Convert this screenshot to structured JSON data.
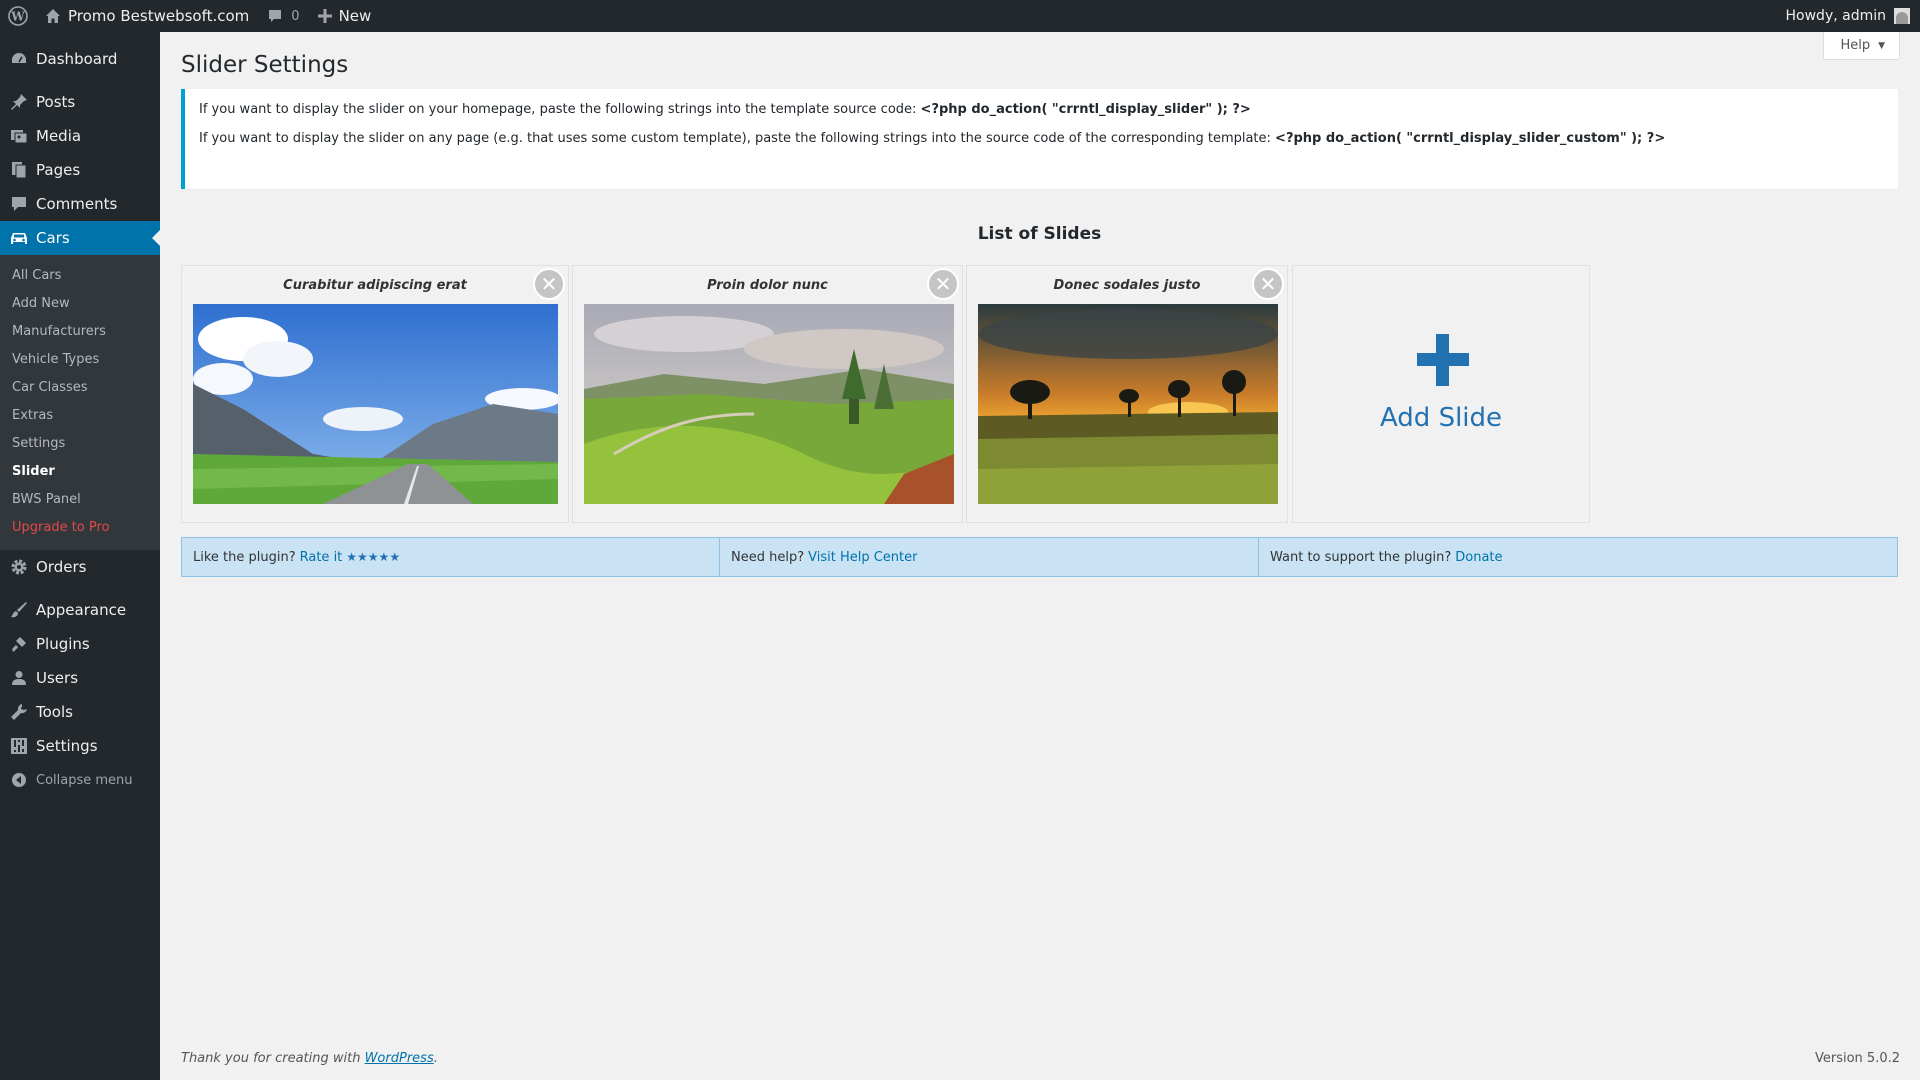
{
  "adminbar": {
    "site_name": "Promo Bestwebsoft.com",
    "comments_count": "0",
    "new_label": "New",
    "howdy": "Howdy, admin"
  },
  "sidebar": {
    "dashboard": "Dashboard",
    "posts": "Posts",
    "media": "Media",
    "pages": "Pages",
    "comments": "Comments",
    "cars": "Cars",
    "cars_submenu": [
      "All Cars",
      "Add New",
      "Manufacturers",
      "Vehicle Types",
      "Car Classes",
      "Extras",
      "Settings",
      "Slider",
      "BWS Panel",
      "Upgrade to Pro"
    ],
    "orders": "Orders",
    "appearance": "Appearance",
    "plugins": "Plugins",
    "users": "Users",
    "tools": "Tools",
    "settings": "Settings",
    "collapse": "Collapse menu"
  },
  "help_tab": "Help",
  "page": {
    "title": "Slider Settings",
    "notice_line1_text": "If you want to display the slider on your homepage, paste the following strings into the template source code: ",
    "notice_line1_code": "<?php do_action( \"crrntl_display_slider\" ); ?>",
    "notice_line2_text": "If you want to display the slider on any page (e.g. that uses some custom template), paste the following strings into the source code of the corresponding template: ",
    "notice_line2_code": "<?php do_action( \"crrntl_display_slider_custom\" ); ?>",
    "list_title": "List of Slides",
    "slides": [
      {
        "title": "Curabitur adipiscing erat"
      },
      {
        "title": "Proin dolor nunc"
      },
      {
        "title": "Donec sodales justo"
      }
    ],
    "add_slide": "Add Slide"
  },
  "bar": {
    "rate_text": "Like the plugin?",
    "rate_link": "Rate it",
    "stars": "★★★★★",
    "help_text": "Need help?",
    "help_link": "Visit Help Center",
    "support_text": "Want to support the plugin?",
    "support_link": "Donate"
  },
  "footer": {
    "thanks_text": "Thank you for creating with ",
    "thanks_link": "WordPress",
    "thanks_end": ".",
    "version": "Version 5.0.2"
  }
}
